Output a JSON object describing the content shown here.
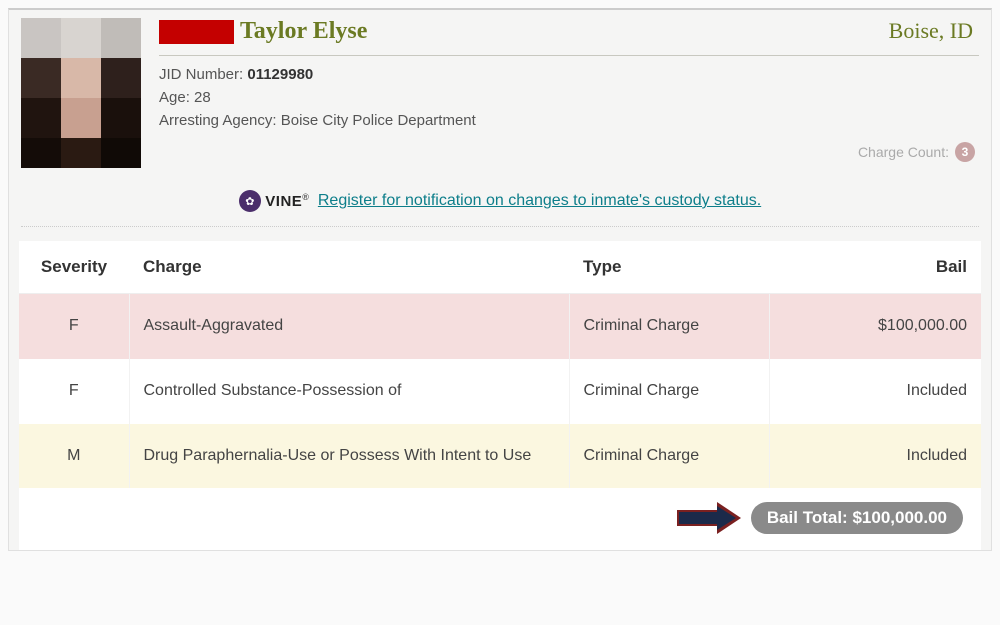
{
  "header": {
    "name": "Taylor Elyse",
    "location": "Boise, ID",
    "jid_label": "JID Number: ",
    "jid_value": "01129980",
    "age_label": "Age: ",
    "age_value": "28",
    "agency_label": "Arresting Agency: ",
    "agency_value": "Boise City Police Department",
    "charge_count_label": "Charge Count:",
    "charge_count": "3"
  },
  "vine": {
    "brand": "VINE",
    "link_text": "Register for notification on changes to inmate's custody status."
  },
  "table": {
    "headers": {
      "severity": "Severity",
      "charge": "Charge",
      "type": "Type",
      "bail": "Bail"
    },
    "rows": [
      {
        "severity": "F",
        "charge": "Assault-Aggravated",
        "type": "Criminal Charge",
        "bail": "$100,000.00"
      },
      {
        "severity": "F",
        "charge": "Controlled Substance-Possession of",
        "type": "Criminal Charge",
        "bail": "Included"
      },
      {
        "severity": "M",
        "charge": "Drug Paraphernalia-Use or Possess With Intent to Use",
        "type": "Criminal Charge",
        "bail": "Included"
      }
    ]
  },
  "total": {
    "label": "Bail Total: ",
    "value": "$100,000.00"
  }
}
